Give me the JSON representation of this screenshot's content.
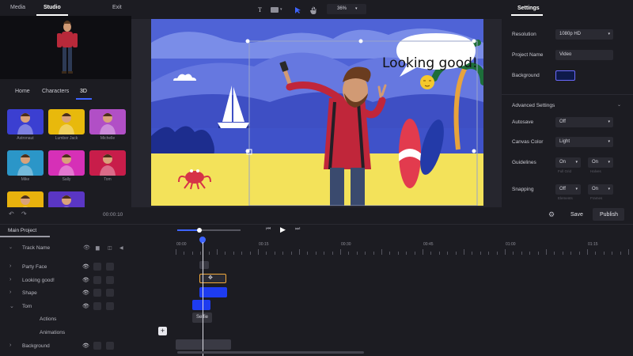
{
  "left_panel": {
    "tabs": [
      "Media",
      "Studio",
      "Exit"
    ],
    "subtabs": [
      "Home",
      "Characters",
      "3D"
    ],
    "characters": [
      {
        "name": "Astronaut",
        "color": "#3b3fd1"
      },
      {
        "name": "Lumber Jack",
        "color": "#e8b90c"
      },
      {
        "name": "Michelle",
        "color": "#b14fc6"
      },
      {
        "name": "Mike",
        "color": "#2b96c8"
      },
      {
        "name": "Sally",
        "color": "#d630b7"
      },
      {
        "name": "Tom",
        "color": "#c81d4a"
      },
      {
        "name": "",
        "color": "#e8b20d"
      },
      {
        "name": "",
        "color": "#5a36c4"
      }
    ]
  },
  "toolbar": {
    "text_tool": "T",
    "zoom": "36%"
  },
  "canvas": {
    "speech_text": "Looking good!"
  },
  "settings": {
    "title": "Settings",
    "rows": [
      {
        "label": "Resolution",
        "value": "1080p HD"
      },
      {
        "label": "Project Name",
        "value": "Video"
      },
      {
        "label": "Background",
        "value": ""
      }
    ],
    "background_color": "#0e1a4a",
    "advanced_title": "Advanced Settings",
    "advanced_rows": [
      {
        "label": "Autosave",
        "value": "Off"
      },
      {
        "label": "Canvas Color",
        "value": "Light"
      }
    ],
    "guidelines": {
      "label": "Guidelines",
      "a": "On",
      "b": "On",
      "hint_a": "Full Grid",
      "hint_b": "Halves"
    },
    "snapping": {
      "label": "Snapping",
      "a": "Off",
      "b": "On",
      "hint_a": "Elements",
      "hint_b": "Frames"
    }
  },
  "actions": {
    "time": "00:00:10",
    "save": "Save",
    "publish": "Publish"
  },
  "timeline": {
    "project_tab": "Main Project",
    "track_header": "Track Name",
    "ticks": [
      "00:00",
      "00:15",
      "00:30",
      "00:45",
      "01:00",
      "01:15"
    ],
    "tracks": [
      {
        "name": "Party Face",
        "expand": "›"
      },
      {
        "name": "Looking good!",
        "expand": "›"
      },
      {
        "name": "Shape",
        "expand": "›"
      },
      {
        "name": "Tom",
        "expand": "⌄"
      },
      {
        "name": "Actions",
        "expand": ""
      },
      {
        "name": "Animations",
        "expand": ""
      },
      {
        "name": "Background",
        "expand": "›"
      }
    ],
    "action_clip": "Selfie",
    "accent": "#1e3cf0"
  }
}
